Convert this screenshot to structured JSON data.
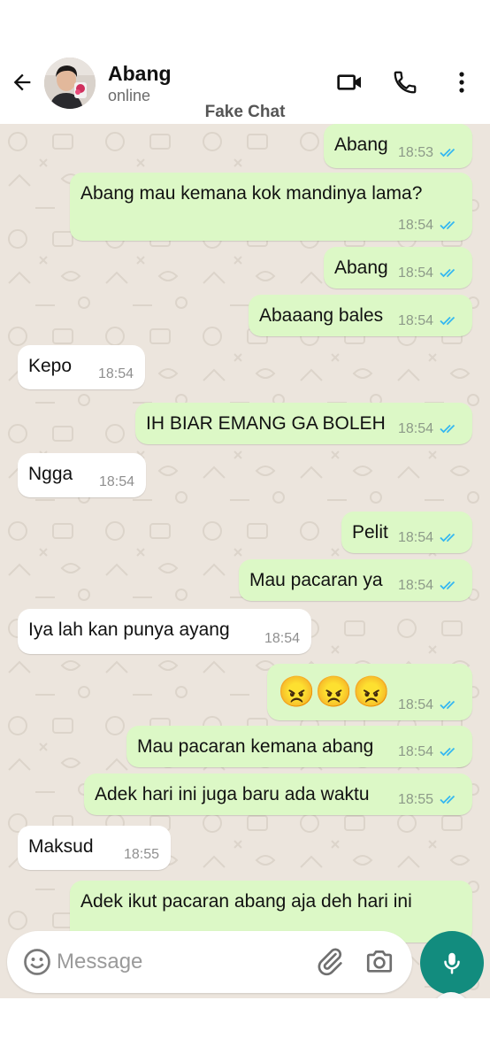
{
  "header": {
    "contact_name": "Abang",
    "contact_status": "online",
    "watermark": "Fake Chat",
    "icons": [
      "back-arrow-icon",
      "video-call-icon",
      "phone-icon",
      "more-options-icon"
    ]
  },
  "messages": [
    {
      "dir": "out",
      "text": "Abang",
      "time": "18:53"
    },
    {
      "dir": "out",
      "text": "Abang mau kemana kok mandinya lama?",
      "time": "18:54"
    },
    {
      "dir": "out",
      "text": "Abang",
      "time": "18:54"
    },
    {
      "dir": "out",
      "text": "Abaaang bales",
      "time": "18:54"
    },
    {
      "dir": "in",
      "text": "Kepo",
      "time": "18:54"
    },
    {
      "dir": "out",
      "text": "IH BIAR EMANG GA BOLEH",
      "time": "18:54"
    },
    {
      "dir": "in",
      "text": "Ngga",
      "time": "18:54"
    },
    {
      "dir": "out",
      "text": "Pelit",
      "time": "18:54"
    },
    {
      "dir": "out",
      "text": "Mau pacaran ya",
      "time": "18:54"
    },
    {
      "dir": "in",
      "text": "Iya lah kan punya ayang",
      "time": "18:54"
    },
    {
      "dir": "out",
      "text": "😠😠😠",
      "time": "18:54"
    },
    {
      "dir": "out",
      "text": "Mau pacaran kemana abang",
      "time": "18:54"
    },
    {
      "dir": "out",
      "text": "Adek hari ini juga baru ada waktu",
      "time": "18:55"
    },
    {
      "dir": "in",
      "text": "Maksud",
      "time": "18:55"
    },
    {
      "dir": "out",
      "text": "Adek ikut pacaran abang aja deh hari ini",
      "time": ""
    }
  ],
  "composer": {
    "placeholder": "Message",
    "value": ""
  },
  "colors": {
    "outgoing_bubble": "#dcf8c6",
    "incoming_bubble": "#ffffff",
    "chat_background": "#ece5dd",
    "read_ticks": "#34b7f1",
    "mic_button": "#128c7e"
  }
}
